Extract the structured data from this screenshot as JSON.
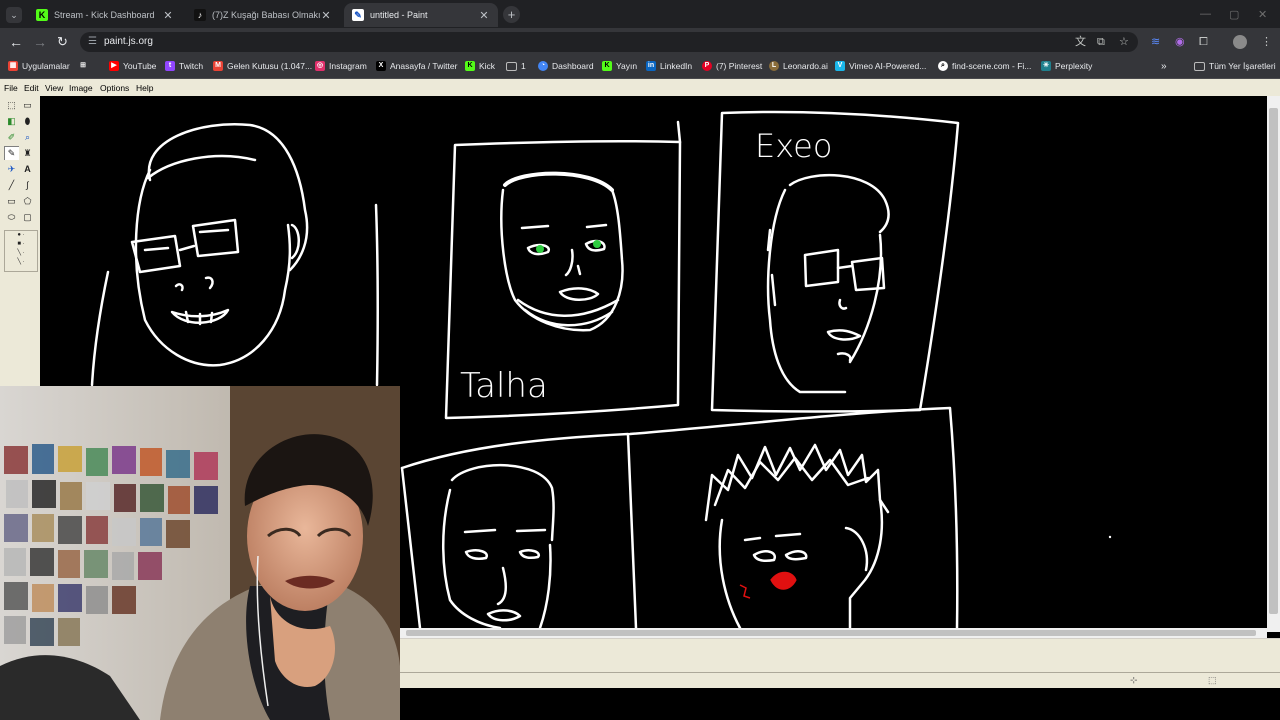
{
  "browser": {
    "tabs": [
      {
        "title": "Stream - Kick Dashboard",
        "icon": "kick-logo-icon",
        "icon_color": "#53fc18",
        "active": false
      },
      {
        "title": "(7)Z Kuşağı Babası Olmakı Kom",
        "icon": "tiktok-icon",
        "icon_color": "#000000",
        "active": false
      },
      {
        "title": "untitled - Paint",
        "icon": "paint-icon",
        "icon_color": "#ffffff",
        "active": true
      }
    ],
    "url": "paint.js.org",
    "bookmarks": [
      {
        "label": "Uygulamalar",
        "icon": "apps-grid-icon",
        "color": "#ea4335"
      },
      {
        "label": "YouTube",
        "icon": "youtube-icon",
        "color": "#ff0000"
      },
      {
        "label": "Twitch",
        "icon": "twitch-icon",
        "color": "#9146ff"
      },
      {
        "label": "Gelen Kutusu (1.047...",
        "icon": "gmail-icon",
        "color": "#ea4335"
      },
      {
        "label": "Instagram",
        "icon": "instagram-icon",
        "color": "#e1306c"
      },
      {
        "label": "Anasayfa / Twitter",
        "icon": "x-twitter-icon",
        "color": "#000000"
      },
      {
        "label": "Kick",
        "icon": "kick-logo-icon",
        "color": "#53fc18"
      },
      {
        "label": "1",
        "icon": "folder-icon",
        "color": "#35363a"
      },
      {
        "label": "Dashboard",
        "icon": "dashboard-icon",
        "color": "#4285f4"
      },
      {
        "label": "Yayın",
        "icon": "kick-logo-icon",
        "color": "#53fc18"
      },
      {
        "label": "LinkedIn",
        "icon": "linkedin-icon",
        "color": "#0a66c2"
      },
      {
        "label": "(7) Pinterest",
        "icon": "pinterest-icon",
        "color": "#e60023"
      },
      {
        "label": "Leonardo.ai",
        "icon": "leonardo-icon",
        "color": "#8a6d3b"
      },
      {
        "label": "Vimeo AI-Powered...",
        "icon": "vimeo-icon",
        "color": "#1ab7ea"
      },
      {
        "label": "find-scene.com - Fi...",
        "icon": "find-scene-icon",
        "color": "#ffffff"
      },
      {
        "label": "Perplexity",
        "icon": "perplexity-icon",
        "color": "#20808d"
      }
    ],
    "all_bookmarks": "Tüm Yer İşaretleri"
  },
  "paint": {
    "menu": [
      "File",
      "Edit",
      "View",
      "Image",
      "Options",
      "Help"
    ],
    "labels": {
      "talha": "Talha",
      "exeo": "Exeo"
    }
  },
  "colors": {
    "eye_green": "#2ecc40",
    "blush_red": "#e01010",
    "kick_green": "#53fc18"
  }
}
